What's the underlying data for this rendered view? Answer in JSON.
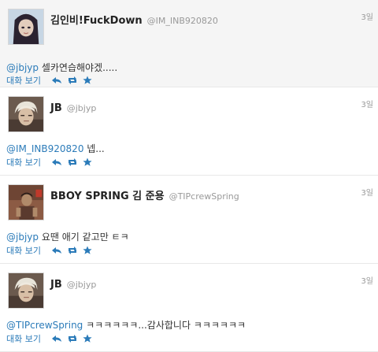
{
  "tweets": [
    {
      "display_name": "김인비!FuckDown",
      "screen_name": "@IM_INB920820",
      "time": "3일",
      "mention": "@jbjyp",
      "text": " 셀카연습해야겠.....",
      "conversation_label": "대화 보기",
      "avatar_colors": [
        "#2a2230",
        "#d9c3b4",
        "#c7d6e4"
      ]
    },
    {
      "display_name": "JB",
      "screen_name": "@jbjyp",
      "time": "3일",
      "mention": "@IM_INB920820",
      "text": " 넵...",
      "conversation_label": "대화 보기",
      "avatar_colors": [
        "#e8e4d9",
        "#c9b098",
        "#6b5a4e"
      ]
    },
    {
      "display_name": "BBOY SPRING 김 준용",
      "screen_name": "@TIPcrewSpring",
      "time": "3일",
      "mention": "@jbjyp",
      "text": " 요땐 애기 같고만 ㅌㅋ",
      "conversation_label": "대화 보기",
      "avatar_colors": [
        "#5a3a2e",
        "#b08a6a",
        "#8c5b44"
      ]
    },
    {
      "display_name": "JB",
      "screen_name": "@jbjyp",
      "time": "3일",
      "mention": "@TIPcrewSpring",
      "text": " ㅋㅋㅋㅋㅋㅋ...감사합니다 ㅋㅋㅋㅋㅋㅋ",
      "conversation_label": "대화 보기",
      "avatar_colors": [
        "#e8e4d9",
        "#c9b098",
        "#6b5a4e"
      ]
    }
  ],
  "colors": {
    "link": "#2b7bb9",
    "muted": "#999999",
    "name": "#222222",
    "first_bg": "#f5f5f5"
  }
}
